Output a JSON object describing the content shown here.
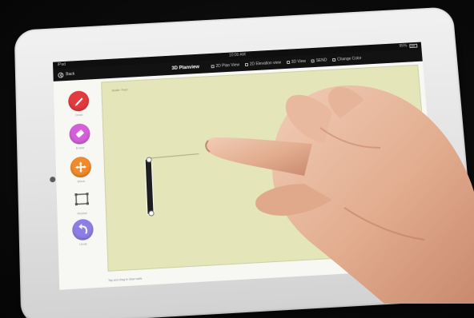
{
  "status_bar": {
    "carrier": "iPad",
    "time": "10:00 AM",
    "battery": "95%"
  },
  "nav": {
    "back_label": "Back",
    "title": "3D Planview",
    "options": [
      "2D Plan View",
      "2D Elevation view",
      "3D View",
      "SEND",
      "Change Color"
    ]
  },
  "tools": [
    {
      "icon": "pencil-icon",
      "color": "#e23a3e",
      "label": "Draw"
    },
    {
      "icon": "eraser-icon",
      "color": "#d45fd8",
      "label": "Erase"
    },
    {
      "icon": "move-icon",
      "color": "#f08a2a",
      "label": "Move"
    },
    {
      "icon": "resize-icon",
      "color": "#555555",
      "label": "Resize"
    },
    {
      "icon": "undo-icon",
      "color": "#8c7ee6",
      "label": "Undo"
    }
  ],
  "canvas": {
    "label": "Scale: Feet",
    "background": "#e4e5b8"
  },
  "bottom_status": "Tap and drag to draw walls"
}
